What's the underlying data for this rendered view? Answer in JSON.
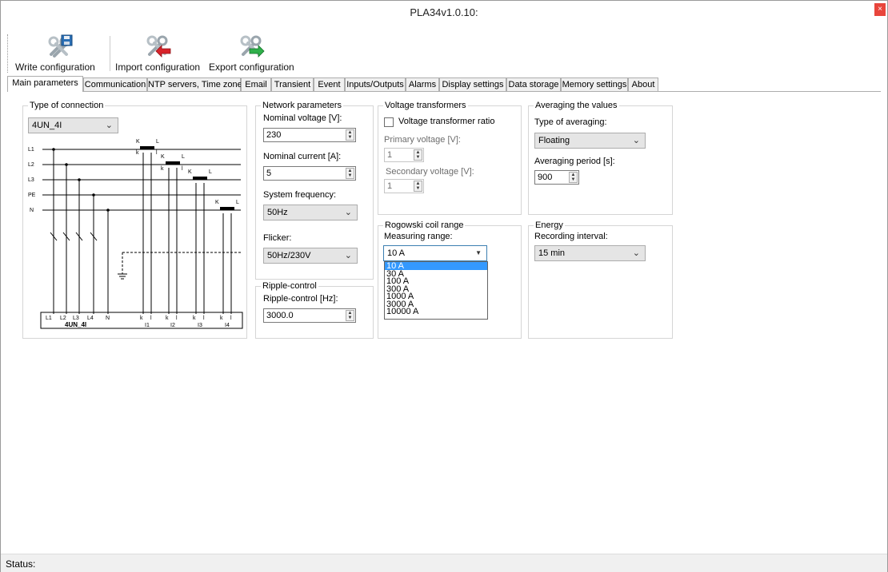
{
  "window": {
    "title": "PLA34v1.0.10:",
    "close_label": "×"
  },
  "toolbar": {
    "write_label": "Write configuration",
    "import_label": "Import configuration",
    "export_label": "Export configuration"
  },
  "tabs": [
    {
      "label": "Main parameters",
      "active": true
    },
    {
      "label": "Communication"
    },
    {
      "label": "NTP servers, Time zone"
    },
    {
      "label": "Email"
    },
    {
      "label": "Transient"
    },
    {
      "label": "Event"
    },
    {
      "label": "Inputs/Outputs"
    },
    {
      "label": "Alarms"
    },
    {
      "label": "Display settings"
    },
    {
      "label": "Data storage"
    },
    {
      "label": "Memory settings"
    },
    {
      "label": "About"
    }
  ],
  "connection": {
    "group_label": "Type of connection",
    "selected": "4UN_4I",
    "diagram": {
      "lines": [
        "L1",
        "L2",
        "L3",
        "PE",
        "N"
      ],
      "ct_labels": [
        "K",
        "L",
        "k",
        "l"
      ],
      "terminal_top": [
        "L1",
        "L2",
        "L3",
        "L4",
        "N",
        "k",
        "l",
        "k",
        "l",
        "k",
        "l",
        "k",
        "l"
      ],
      "terminal_name": "4UN_4I",
      "current_labels": [
        "I1",
        "I2",
        "I3",
        "I4"
      ]
    }
  },
  "network": {
    "group_label": "Network parameters",
    "nominal_voltage_label": "Nominal voltage [V]:",
    "nominal_voltage_value": "230",
    "nominal_current_label": "Nominal current [A]:",
    "nominal_current_value": "5",
    "system_frequency_label": "System frequency:",
    "system_frequency_value": "50Hz",
    "flicker_label": "Flicker:",
    "flicker_value": "50Hz/230V"
  },
  "ripple": {
    "group_label": "Ripple-control",
    "label": "Ripple-control [Hz]:",
    "value": "3000.0"
  },
  "vt": {
    "group_label": "Voltage transformers",
    "ratio_label": "Voltage transformer ratio",
    "ratio_checked": false,
    "primary_label": "Primary voltage [V]:",
    "primary_value": "1",
    "secondary_label": "Secondary voltage [V]:",
    "secondary_value": "1"
  },
  "rogowski": {
    "group_label": "Rogowski coil range",
    "range_label": "Measuring range:",
    "selected": "10 A",
    "options": [
      "10 A",
      "30 A",
      "100 A",
      "300 A",
      "1000 A",
      "3000 A",
      "10000 A"
    ]
  },
  "averaging": {
    "group_label": "Averaging the values",
    "type_label": "Type of averaging:",
    "type_value": "Floating",
    "period_label": "Averaging period [s]:",
    "period_value": "900"
  },
  "energy": {
    "group_label": "Energy",
    "interval_label": "Recording interval:",
    "interval_value": "15 min"
  },
  "status": {
    "label": "Status:"
  },
  "colors": {
    "accent": "#3399ff",
    "close": "#e8453c"
  }
}
